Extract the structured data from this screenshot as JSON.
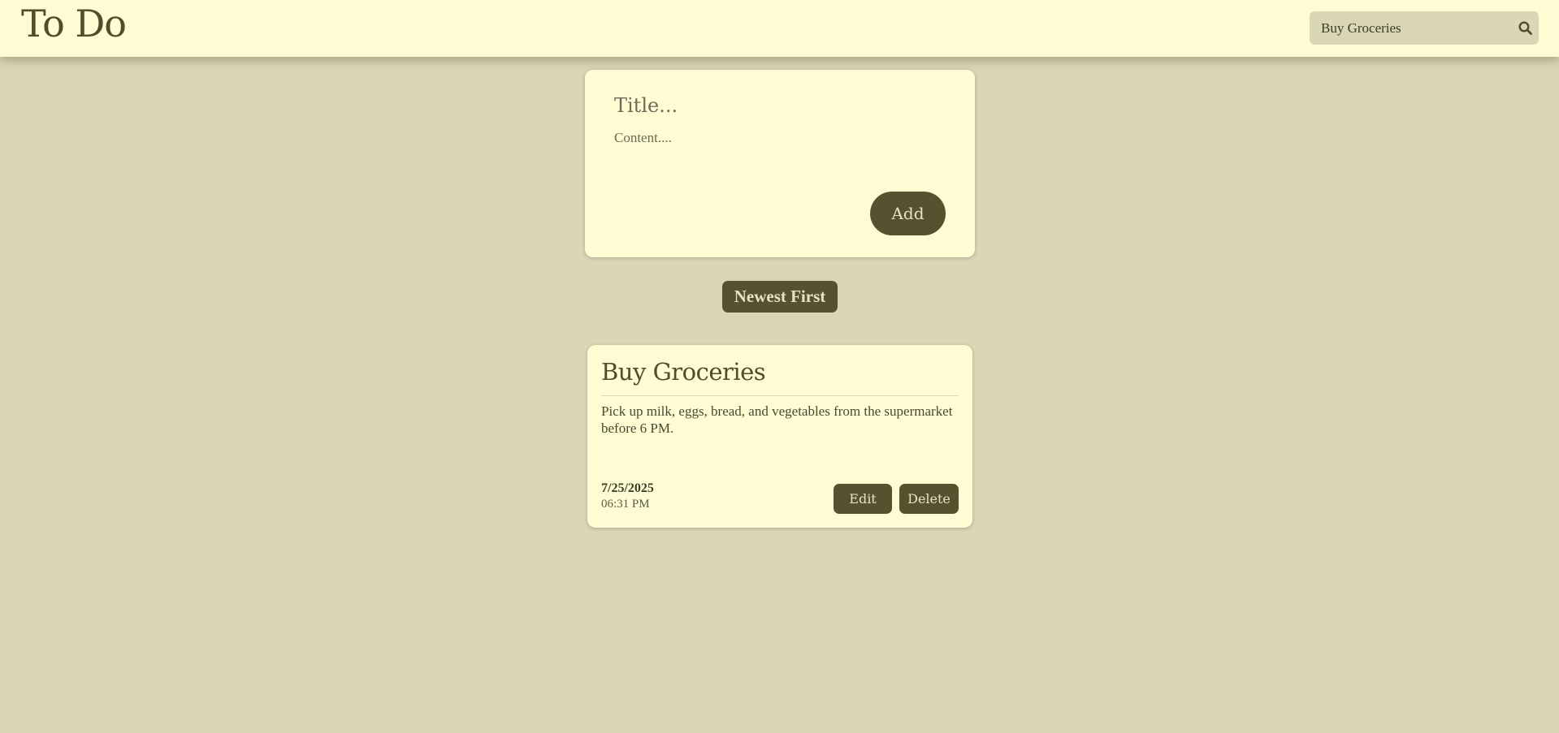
{
  "header": {
    "app_title": "To Do",
    "search": {
      "value": "Buy Groceries",
      "icon": "search-icon"
    }
  },
  "create_form": {
    "title_placeholder": "Title...",
    "content_placeholder": "Content....",
    "add_label": "Add"
  },
  "sort": {
    "label": "Newest First"
  },
  "notes": [
    {
      "title": "Buy Groceries",
      "content": "Pick up milk, eggs, bread, and vegetables from the supermarket before 6 PM.",
      "date": "7/25/2025",
      "time": "06:31 PM",
      "edit_label": "Edit",
      "delete_label": "Delete"
    }
  ],
  "colors": {
    "background": "#dad7b6",
    "surface": "#fefcd3",
    "accent": "#55532f",
    "accent_text": "#e6e3c3"
  }
}
